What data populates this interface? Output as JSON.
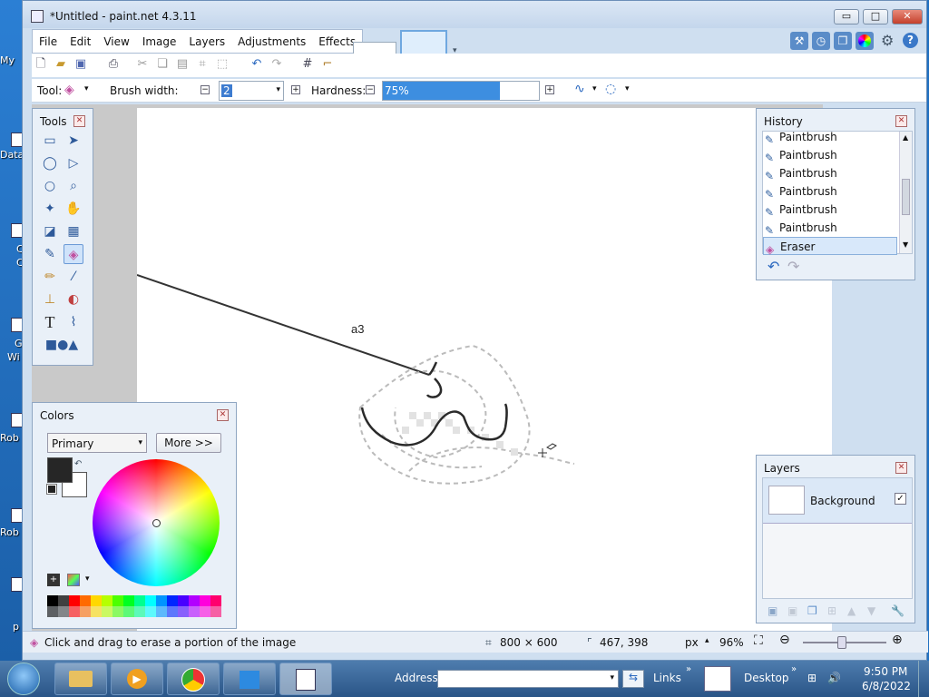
{
  "desktop": {
    "labels": [
      "My",
      "Data",
      "C",
      "C",
      "G",
      "Wi",
      "Rob",
      "Rob",
      "p"
    ]
  },
  "window": {
    "title": "*Untitled - paint.net 4.3.11",
    "caption_min": "▭",
    "caption_max": "□",
    "caption_close": "✕"
  },
  "menu": {
    "items": [
      "File",
      "Edit",
      "View",
      "Image",
      "Layers",
      "Adjustments",
      "Effects"
    ]
  },
  "toolbar2": {
    "tool_label": "Tool:",
    "brush_width_label": "Brush width:",
    "brush_width_value": "2",
    "hardness_label": "Hardness:",
    "hardness_value": "75%",
    "hardness_fraction": 0.75
  },
  "canvas": {
    "annotation_label": "a3"
  },
  "tools_panel": {
    "title": "Tools",
    "tools": [
      "rectangle-select-icon",
      "move-selection-icon",
      "lasso-select-icon",
      "move-selected-icon",
      "ellipse-select-icon",
      "zoom-icon",
      "magic-wand-icon",
      "pan-icon",
      "paint-bucket-icon",
      "gradient-icon",
      "paintbrush-icon",
      "eraser-icon",
      "pencil-icon",
      "color-picker-icon",
      "clone-stamp-icon",
      "recolor-icon",
      "text-icon",
      "line-curve-icon",
      "shapes-icon"
    ]
  },
  "colors_panel": {
    "title": "Colors",
    "mode_select": "Primary",
    "more_button": "More >>",
    "primary_color": "#262626",
    "secondary_color": "#ffffff",
    "palette": [
      "#000000",
      "#404040",
      "#ff0000",
      "#ff6a00",
      "#ffd800",
      "#b6ff00",
      "#4cff00",
      "#00ff21",
      "#00ff90",
      "#00ffff",
      "#0094ff",
      "#0026ff",
      "#4800ff",
      "#b200ff",
      "#ff00dc",
      "#ff006e"
    ]
  },
  "history_panel": {
    "title": "History",
    "items": [
      "Paintbrush",
      "Paintbrush",
      "Paintbrush",
      "Paintbrush",
      "Paintbrush",
      "Paintbrush",
      "Eraser"
    ]
  },
  "layers_panel": {
    "title": "Layers",
    "layer_name": "Background"
  },
  "status": {
    "hint": "Click and drag to erase a portion of the image",
    "image_size": "800 × 600",
    "cursor_pos": "467, 398",
    "units": "px",
    "zoom": "96%"
  },
  "taskbar": {
    "address_label": "Address",
    "links_label": "Links",
    "desktop_label": "Desktop",
    "time": "9:50 PM",
    "date": "6/8/2022"
  }
}
